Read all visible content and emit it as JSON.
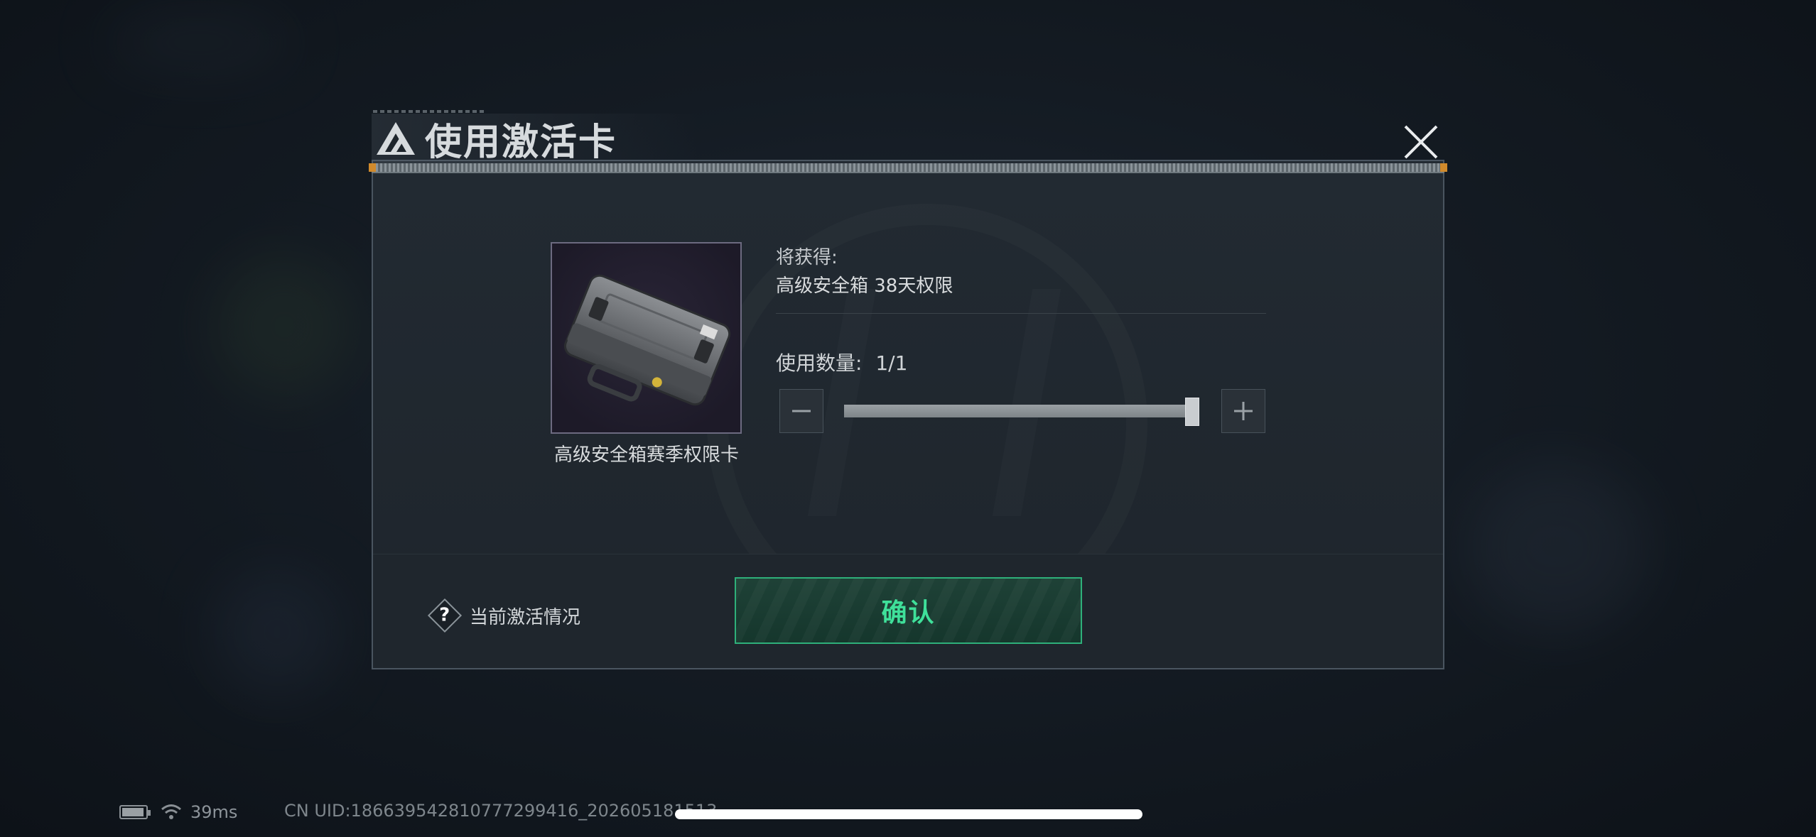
{
  "dialog": {
    "title": "使用激活卡",
    "item": {
      "name": "高级安全箱赛季权限卡",
      "icon": "secure-case-icon"
    },
    "gain_label": "将获得:",
    "gain_value": "高级安全箱 38天权限",
    "quantity": {
      "label": "使用数量:",
      "current": 1,
      "max": 1,
      "display": "1/1",
      "fill_fraction": 1.0
    },
    "activation_status_label": "当前激活情况",
    "confirm_label": "确认",
    "colors": {
      "accent_green": "#3fe09a",
      "border_green": "#2eb07a",
      "orange_marker": "#d08a2c"
    }
  },
  "status_bar": {
    "ping": "39ms",
    "uid": "CN UID:186639542810777299416_202605181513"
  }
}
